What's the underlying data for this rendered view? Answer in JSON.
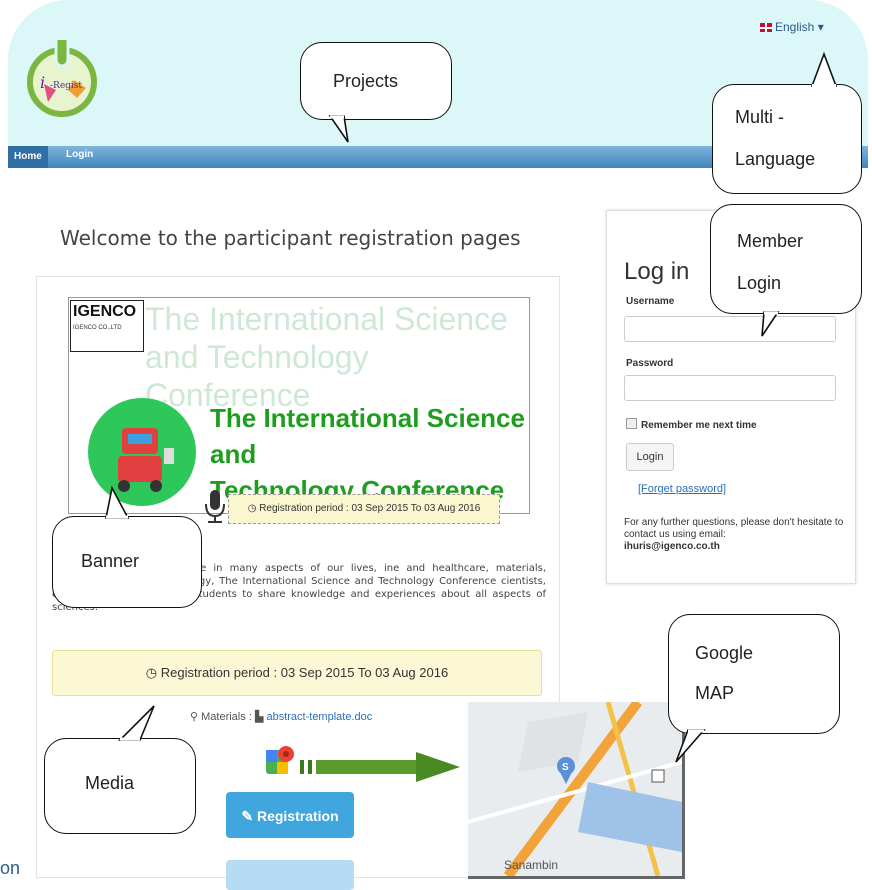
{
  "header": {
    "language": "English",
    "nav": {
      "home": "Home",
      "login": "Login"
    }
  },
  "welcome": "Welcome to the participant registration pages",
  "banner": {
    "company": "IGENCO",
    "company_sub": "IGENCO CO.,LTD",
    "title": "The International Science and Technology Conference",
    "title_line1": "The International Science and",
    "title_line2": "Technology Conference",
    "period": "Registration period :  03 Sep 2015 To 03 Aug 2016"
  },
  "description": "as played an important role in many aspects of our lives, ine and healthcare, materials, environment, forensics, energy, The International Science and Technology Conference cientists, engineers, academics and students to share knowledge and experiences about all aspects of sciences.",
  "period_text": "Registration period :  03 Sep 2015 To 03 Aug 2016",
  "materials": {
    "label": "Materials :",
    "file": "abstract-template.doc"
  },
  "registration_button": "Registration",
  "stray_text": "on",
  "login": {
    "title": "Log in",
    "username_label": "Username",
    "password_label": "Password",
    "remember": "Remember me next time",
    "button": "Login",
    "forgot": "[Forget password]",
    "contact": "For any further questions, please don't hesitate to contact us using email:",
    "email": "ihuris@igenco.co.th"
  },
  "map": {
    "place": "Sanambin"
  },
  "callouts": {
    "projects": "Projects",
    "multi_language": [
      "Multi -",
      "Language"
    ],
    "member_login": [
      "Member",
      "Login"
    ],
    "banner": "Banner",
    "google_map": [
      "Google",
      "MAP"
    ],
    "media": "Media"
  },
  "colors": {
    "header_bg": "#dcf7f7",
    "nav_bar": "#3f86bf",
    "banner_green": "#1f9d1f",
    "registration_button": "#3fa7dd",
    "period_box": "#fcf8d6"
  }
}
